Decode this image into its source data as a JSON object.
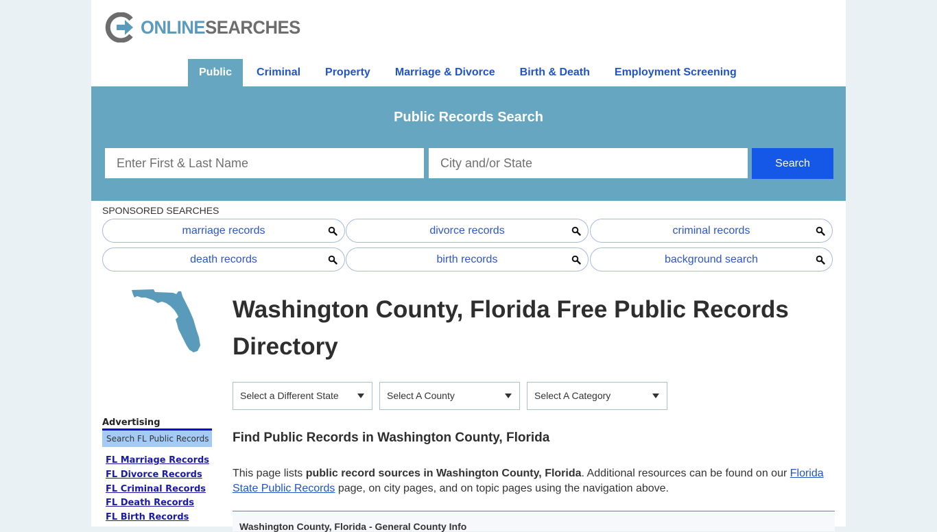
{
  "brand": {
    "online": "ONLINE",
    "searches": "SEARCHES"
  },
  "nav": {
    "items": [
      {
        "label": "Public",
        "active": true
      },
      {
        "label": "Criminal",
        "active": false
      },
      {
        "label": "Property",
        "active": false
      },
      {
        "label": "Marriage & Divorce",
        "active": false
      },
      {
        "label": "Birth & Death",
        "active": false
      },
      {
        "label": "Employment Screening",
        "active": false
      }
    ]
  },
  "hero": {
    "title": "Public Records Search",
    "name_placeholder": "Enter First & Last Name",
    "name_value": "",
    "city_placeholder": "City and/or State",
    "city_value": "",
    "search_label": "Search"
  },
  "sponsored": {
    "label": "SPONSORED SEARCHES",
    "items": [
      {
        "label": "marriage records",
        "icon": "search-icon"
      },
      {
        "label": "divorce records",
        "icon": "search-icon"
      },
      {
        "label": "criminal records",
        "icon": "search-icon"
      },
      {
        "label": "death records",
        "icon": "search-icon"
      },
      {
        "label": "birth records",
        "icon": "search-icon"
      },
      {
        "label": "background search",
        "icon": "search-icon"
      }
    ]
  },
  "sidebar": {
    "advertising_title": "Advertising",
    "search_box_label": "Search FL Public Records",
    "links": [
      {
        "label": "FL Marriage Records"
      },
      {
        "label": "FL Divorce Records"
      },
      {
        "label": "FL Criminal Records"
      },
      {
        "label": "FL Death Records"
      },
      {
        "label": "FL Birth Records"
      }
    ]
  },
  "main": {
    "title": "Washington County, Florida Free Public Records Directory",
    "selects": {
      "state": "Select a Different State",
      "county": "Select A County",
      "category": "Select A Category"
    },
    "subtitle": "Find Public Records in Washington County, Florida",
    "intro": {
      "before": "This page lists ",
      "bold": "public record sources in Washington County, Florida",
      "middle": ". Additional resources can be found on our ",
      "link": "Florida State Public Records",
      "after": " page, on city pages, and on topic pages using the navigation above."
    },
    "info_box_title": "Washington County, Florida - General County Info"
  },
  "colors": {
    "accent": "#67a6c1",
    "button": "#1557e6",
    "link": "#1f55c4",
    "page_bg": "#eaf1f5"
  }
}
